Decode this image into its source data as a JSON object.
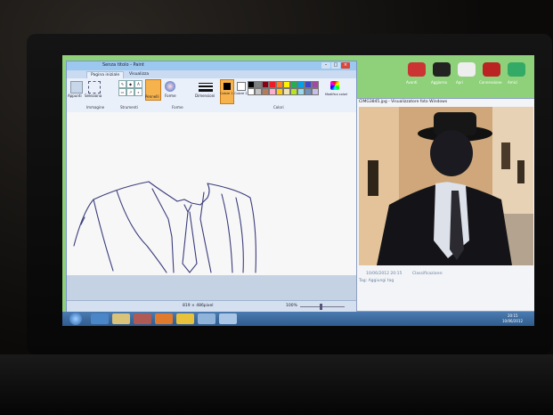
{
  "paint": {
    "title": "Senza titolo - Paint",
    "tabs": [
      "Pagina iniziale",
      "Visualizza"
    ],
    "groups": [
      "Appunti",
      "Immagine",
      "Strumenti",
      "Forme",
      "Colori"
    ],
    "buttons": {
      "clipboard": "Appunti",
      "select": "Seleziona",
      "brushes": "Pennelli",
      "shapes": "Forme",
      "size": "Dimensioni",
      "color1": "Colore 1",
      "color2": "Colore 2",
      "edit_colors": "Modifica colori"
    },
    "status": {
      "dimensions": "819 × 486pixel",
      "zoom": "100%"
    }
  },
  "viewer": {
    "title": "CIMG3845.jpg - Visualizzatore foto Windows",
    "date": "10/06/2012 20:15",
    "rating_label": "Classificazione:",
    "tag_label": "Tag: Aggiungi tag"
  },
  "desktop_icons": [
    "Avanti",
    "Aggiorna",
    "Apri",
    "Connessione",
    "Amici"
  ],
  "taskbar": {
    "time": "20:15",
    "date": "10/06/2012"
  },
  "colors": {
    "desktop_green": "#8fd17a",
    "palette": [
      "#000000",
      "#7f7f7f",
      "#880015",
      "#ed1c24",
      "#ff7f27",
      "#fff200",
      "#22b14c",
      "#00a2e8",
      "#3f48cc",
      "#a349a4",
      "#ffffff",
      "#c3c3c3",
      "#b97a57",
      "#ffaec9",
      "#ffc90e",
      "#efe4b0",
      "#b5e61d",
      "#99d9ea",
      "#7092be",
      "#c8bfe7"
    ]
  }
}
